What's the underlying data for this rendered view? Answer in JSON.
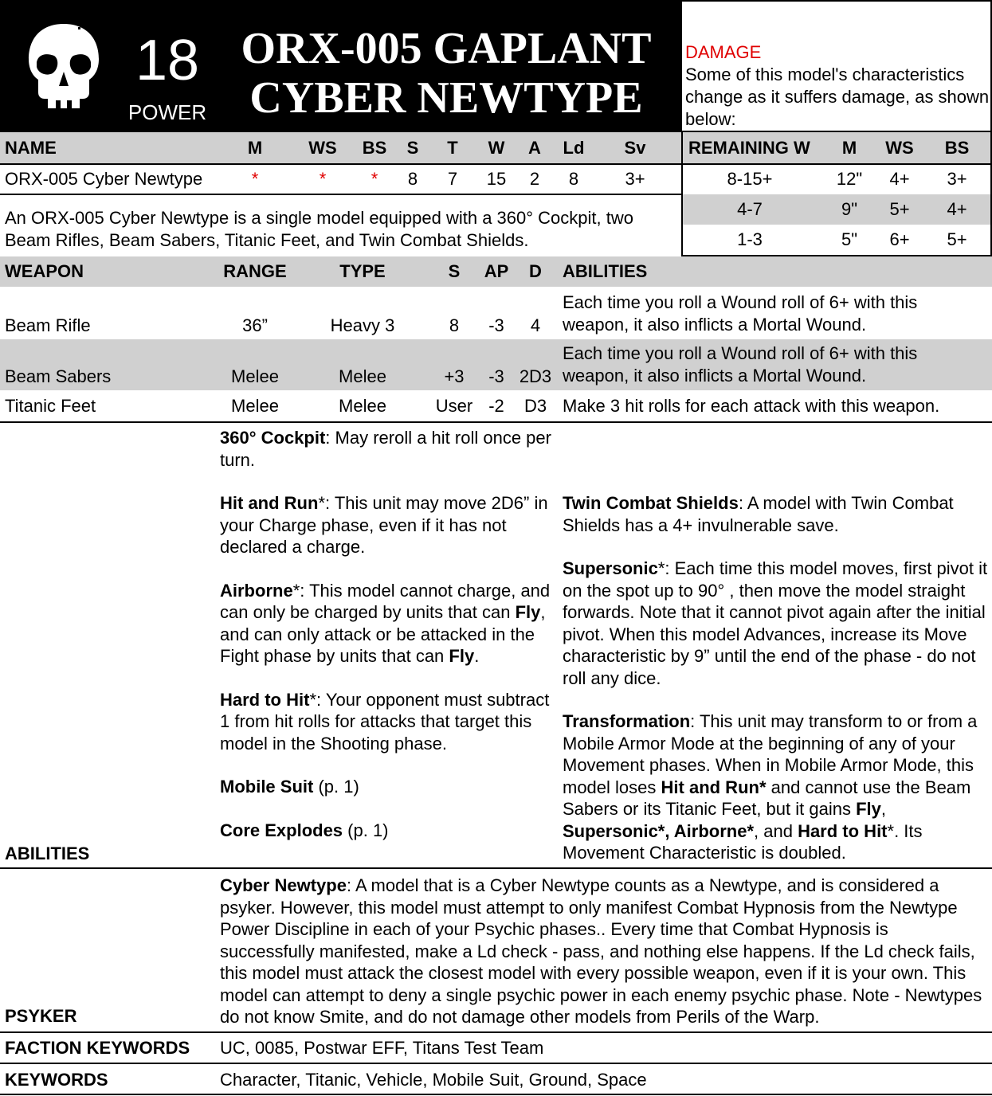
{
  "header": {
    "power_value": "18",
    "power_label": "POWER",
    "title_line1": "ORX-005 GAPLANT",
    "title_line2": "CYBER NEWTYPE"
  },
  "damage": {
    "title": "DAMAGE",
    "text": "Some of this model's characteristics change as it suffers damage, as shown below:",
    "headers": [
      "REMAINING W",
      "M",
      "WS",
      "BS"
    ],
    "rows": [
      [
        "8-15+",
        "12\"",
        "4+",
        "3+"
      ],
      [
        "4-7",
        "9\"",
        "5+",
        "4+"
      ],
      [
        "1-3",
        "5\"",
        "6+",
        "5+"
      ]
    ]
  },
  "stats": {
    "headers": [
      "NAME",
      "M",
      "WS",
      "BS",
      "S",
      "T",
      "W",
      "A",
      "Ld",
      "Sv"
    ],
    "row": [
      "ORX-005 Cyber Newtype",
      "*",
      "*",
      "*",
      "8",
      "7",
      "15",
      "2",
      "8",
      "3+"
    ]
  },
  "description": "An ORX-005 Cyber Newtype is a single model equipped with a 360° Cockpit, two Beam Rifles, Beam Sabers, Titanic Feet, and Twin Combat Shields.",
  "weapons": {
    "headers": [
      "WEAPON",
      "RANGE",
      "TYPE",
      "S",
      "AP",
      "D",
      "ABILITIES"
    ],
    "rows": [
      {
        "name": "Beam Rifle",
        "range": "36”",
        "type": "Heavy 3",
        "s": "8",
        "ap": "-3",
        "d": "4",
        "abilities_1": "Each time you roll a Wound roll of 6+ with this",
        "abilities_2": "weapon, it also inflicts a Mortal Wound."
      },
      {
        "name": "Beam Sabers",
        "range": "Melee",
        "type": "Melee",
        "s": "+3",
        "ap": "-3",
        "d": "2D3",
        "abilities_1": "Each time you roll a Wound roll of 6+ with this",
        "abilities_2": "weapon, it also inflicts a Mortal Wound."
      },
      {
        "name": "Titanic Feet",
        "range": "Melee",
        "type": "Melee",
        "s": "User",
        "ap": "-2",
        "d": "D3",
        "abilities_1": "Make 3 hit rolls for each attack with this weapon.",
        "abilities_2": ""
      }
    ]
  },
  "abilities": {
    "label": "ABILITIES",
    "cockpit_name": "360° Cockpit",
    "cockpit_text": ": May reroll a hit roll once per turn.",
    "hitrun_name": "Hit and Run",
    "hitrun_text": "*: This unit may move 2D6” in your Charge phase, even if it has not declared a charge.",
    "airborne_name": "Airborne",
    "airborne_text_a": "*: This model cannot charge, and can only be charged by units that can ",
    "airborne_fly1": "Fly",
    "airborne_text_b": ", and can only attack or be attacked in the Fight phase by units that can ",
    "airborne_fly2": "Fly",
    "airborne_text_c": ".",
    "hardhit_name": "Hard to Hit",
    "hardhit_text": "*: Your opponent must subtract 1 from hit rolls for attacks that target this model in the Shooting phase.",
    "mobile_name": "Mobile Suit",
    "mobile_text": " (p. 1)",
    "core_name": "Core Explodes",
    "core_text": " (p. 1)",
    "shields_name": "Twin Combat Shields",
    "shields_text": ": A model with Twin Combat Shields has a 4+ invulnerable save.",
    "supersonic_name": "Supersonic",
    "supersonic_text": "*: Each time this model moves, first pivot it on the spot up to 90° , then move the model straight forwards.  Note that it cannot pivot again after the initial pivot.  When this model Advances, increase its Move characteristic by 9” until the end of the phase - do not roll any dice.",
    "transform_name": "Transformation",
    "transform_text_a": ": This unit may transform to or from a Mobile Armor Mode at the beginning of any of your Movement phases.  When in Mobile Armor Mode, this model loses ",
    "transform_hitrun": "Hit and Run*",
    "transform_text_b": " and cannot use the Beam Sabers or its Titanic Feet, but it gains ",
    "transform_fly": "Fly",
    "transform_sep1": ", ",
    "transform_super": "Supersonic*, Airborne*",
    "transform_text_c": ", and ",
    "transform_hard": "Hard to Hit",
    "transform_text_d": "*. Its Movement Characteristic is doubled."
  },
  "psyker": {
    "label": "PSYKER",
    "name": "Cyber Newtype",
    "text": ": A model that is a Cyber Newtype counts as a Newtype, and is considered a psyker.  However, this model must attempt to only manifest Combat Hypnosis from the Newtype Power Discipline in each of your Psychic phases.. Every time that Combat Hypnosis is successfully manifested, make a Ld check - pass, and nothing else happens. If the Ld check fails, this model must attack the closest model with every possible weapon, even if it is your own.  This model can attempt to deny a single psychic power in each enemy psychic phase. Note - Newtypes do not know Smite, and do not damage other models from Perils of the Warp."
  },
  "faction": {
    "label": "FACTION KEYWORDS",
    "value": "UC, 0085, Postwar EFF, Titans Test Team"
  },
  "keywords": {
    "label": "KEYWORDS",
    "value": "Character, Titanic, Vehicle, Mobile Suit, Ground, Space"
  }
}
